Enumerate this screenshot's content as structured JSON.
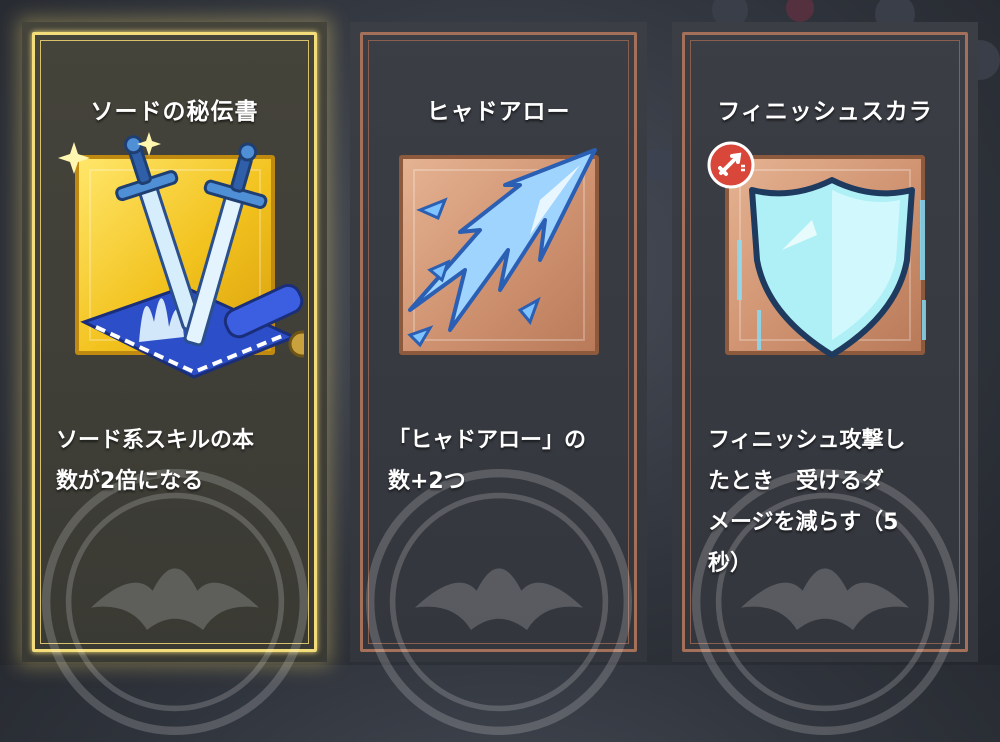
{
  "cards": [
    {
      "title": "ソードの秘伝書",
      "description": "ソード系スキルの本\n数が2倍になる",
      "icon": "swords-scroll-icon",
      "selected": true
    },
    {
      "title": "ヒャドアロー",
      "description": "「ヒャドアロー」の\n数+2つ",
      "icon": "ice-arrow-icon",
      "selected": false
    },
    {
      "title": "フィニッシュスカラ",
      "description": "フィニッシュ攻撃し\nたとき　受けるダ\nメージを減らす（5\n秒）",
      "icon": "ice-shield-icon",
      "badge_icon": "sword-buff-badge-icon",
      "selected": false
    }
  ],
  "colors": {
    "selected_frame": "#f3dd7a",
    "default_frame": "#a4705a",
    "gold_tile": "#f2c21e",
    "bronze_tile": "#cf9270",
    "badge_red": "#d9463a"
  }
}
